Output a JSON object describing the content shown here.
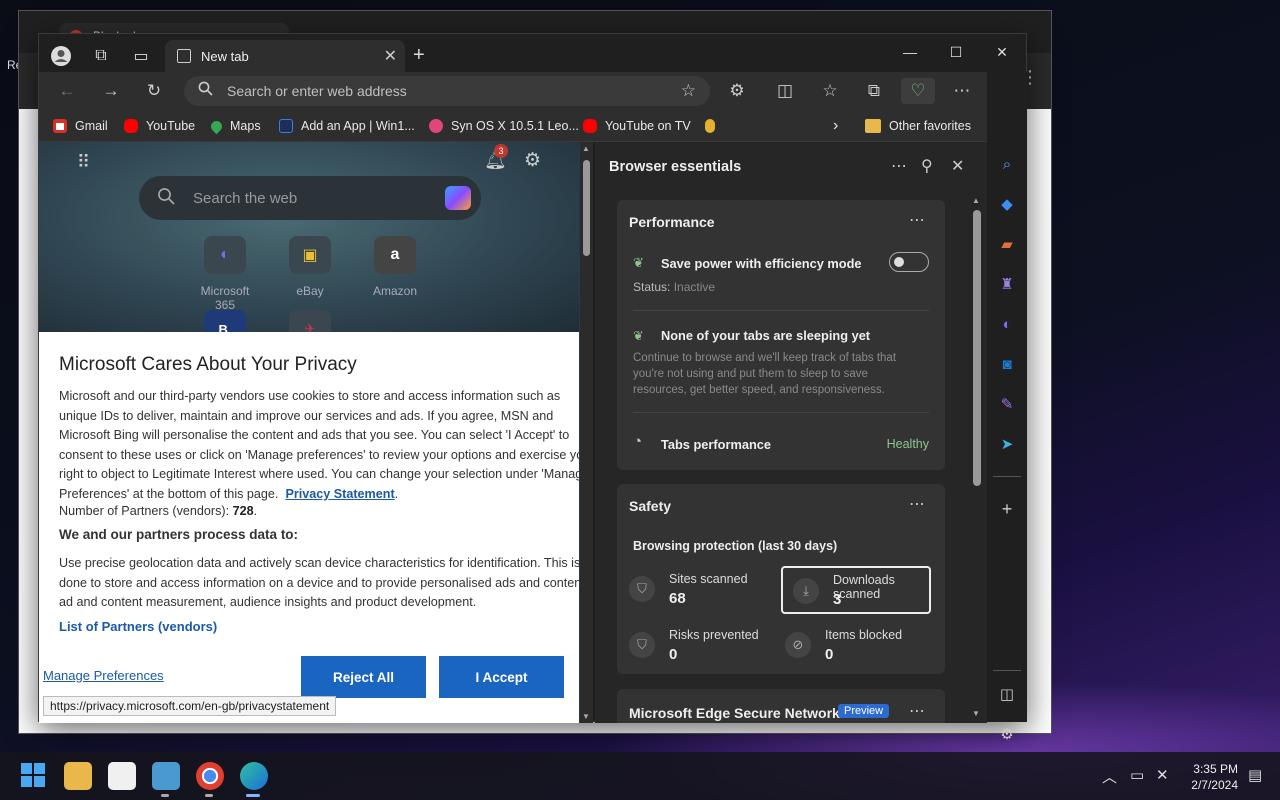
{
  "background": {
    "bg_tab_title": "Blocked",
    "desktop_labels": [
      "Re",
      "M"
    ]
  },
  "browser": {
    "tab_title": "New tab",
    "address_placeholder": "Search or enter web address",
    "favorites": [
      {
        "label": "Gmail",
        "color": "#d93025"
      },
      {
        "label": "YouTube",
        "color": "#ff0000"
      },
      {
        "label": "Maps",
        "color": "#34a853"
      },
      {
        "label": "Add an App | Win1...",
        "color": "#3b7de0"
      },
      {
        "label": "Syn OS X 10.5.1 Leo...",
        "color": "#e0457b"
      },
      {
        "label": "YouTube on TV",
        "color": "#ff0000"
      }
    ],
    "other_favorites": "Other favorites"
  },
  "ntp": {
    "search_placeholder": "Search the web",
    "notification_count": "3",
    "tiles": [
      {
        "label": "Microsoft 365",
        "glyph": "◐"
      },
      {
        "label": "eBay",
        "glyph": "▣"
      },
      {
        "label": "Amazon",
        "glyph": "a"
      }
    ],
    "partial_tiles": [
      "B.",
      "✈"
    ]
  },
  "privacy": {
    "title": "Microsoft Cares About Your Privacy",
    "body": "Microsoft and our third-party vendors use cookies to store and access information such as unique IDs to deliver, maintain and improve our services and ads. If you agree, MSN and Microsoft Bing will personalise the content and ads that you see. You can select 'I Accept' to consent to these uses or click on 'Manage preferences' to review your options and exercise your right to object to Legitimate Interest where used.  You can change your selection under 'Manage Preferences' at the bottom of this page.",
    "privacy_link": "Privacy Statement",
    "partners_label": "Number of Partners (vendors): ",
    "partners_count": "728",
    "purpose_heading": "We and our partners process data to:",
    "purpose_text": "Use precise geolocation data and actively scan device characteristics for identification. This is done to store and access information on a device and to provide personalised ads and content, ad and content measurement, audience insights and product development.",
    "partners_list_link": "List of Partners (vendors)",
    "manage_link": "Manage Preferences",
    "reject_label": "Reject All",
    "accept_label": "I Accept",
    "status_url": "https://privacy.microsoft.com/en-gb/privacystatement"
  },
  "essentials": {
    "title": "Browser essentials",
    "performance": {
      "title": "Performance",
      "efficiency_label": "Save power with efficiency mode",
      "status_label": "Status:",
      "status_value": "Inactive",
      "efficiency_on": false,
      "sleeping_title": "None of your tabs are sleeping yet",
      "sleeping_desc": "Continue to browse and we'll keep track of tabs that you're not using and put them to sleep to save resources, get better speed, and responsiveness.",
      "tabs_perf_label": "Tabs performance",
      "tabs_perf_value": "Healthy"
    },
    "safety": {
      "title": "Safety",
      "subtitle": "Browsing protection (last 30 days)",
      "stats": [
        {
          "label": "Sites scanned",
          "value": "68"
        },
        {
          "label": "Downloads scanned",
          "value": "3"
        },
        {
          "label": "Risks prevented",
          "value": "0"
        },
        {
          "label": "Items blocked",
          "value": "0"
        }
      ]
    },
    "secure_network": {
      "title": "Microsoft Edge Secure Network",
      "badge": "Preview"
    }
  },
  "taskbar": {
    "time": "3:35 PM",
    "date": "2/7/2024"
  }
}
